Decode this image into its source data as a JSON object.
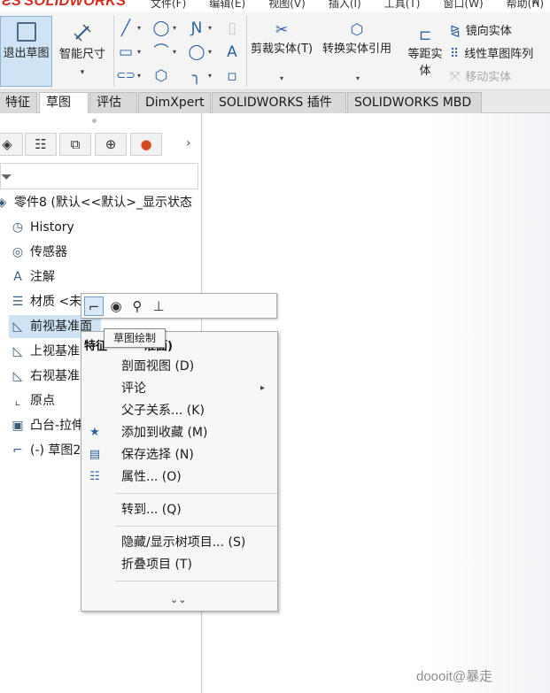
{
  "app": {
    "logo_ds": "ƧS",
    "logo_name": "SOLIDWORKS",
    "menu": [
      "文件(F)",
      "编辑(E)",
      "视图(V)",
      "插入(I)",
      "工具(T)",
      "窗口(W)",
      "帮助(H)"
    ],
    "pin": "⊼"
  },
  "ribbon": {
    "exit_sketch": "退出草图",
    "smart_dim": "智能尺寸",
    "trim": "剪裁实体(T)",
    "convert": "转换实体引用",
    "offset_line1": "等距实",
    "offset_line2": "体",
    "mirror": "镜向实体",
    "linear_pattern": "线性草图阵列",
    "move": "移动实体",
    "sketch_tools": {
      "line": "╱",
      "circle": "◯",
      "spline": "Ɲ",
      "rect": "▭",
      "arc": "⌒",
      "polygon": "◯",
      "slot": "⊂⊃",
      "hexagon": "⬡",
      "fillet": "╮",
      "text": "A",
      "point": "▫",
      "plane3d": "▯"
    }
  },
  "tabs": [
    "特征",
    "草图",
    "评估",
    "DimXpert",
    "SOLIDWORKS 插件",
    "SOLIDWORKS MBD"
  ],
  "tabs_active": 1,
  "panel": {
    "tab_arrow": "›",
    "tree": [
      {
        "icon": "part-icon",
        "glyph": "◈",
        "label": "零件8  (默认<<默认>_显示状态"
      },
      {
        "icon": "history-icon",
        "glyph": "◷",
        "label": "History"
      },
      {
        "icon": "sensor-icon",
        "glyph": "◎",
        "label": "传感器"
      },
      {
        "icon": "annotation-icon",
        "glyph": "A",
        "label": "注解"
      },
      {
        "icon": "material-icon",
        "glyph": "☰",
        "label": "材质 <未"
      },
      {
        "icon": "plane-icon",
        "glyph": "◺",
        "label": "前视基准面"
      },
      {
        "icon": "plane-icon",
        "glyph": "◺",
        "label": "上视基准"
      },
      {
        "icon": "plane-icon",
        "glyph": "◺",
        "label": "右视基准"
      },
      {
        "icon": "origin-icon",
        "glyph": "⌞",
        "label": "原点"
      },
      {
        "icon": "extrude-icon",
        "glyph": "▣",
        "label": "凸台-拉伸"
      },
      {
        "icon": "sketch-icon",
        "glyph": "⌐",
        "label": "(-) 草图2"
      }
    ]
  },
  "tooltip": "草图绘制",
  "context_menu": {
    "title_prefix": "特征",
    "title_suffix": "准面)",
    "items": [
      {
        "label": "剖面视图 (D)",
        "icon": ""
      },
      {
        "label": "评论",
        "icon": "",
        "submenu": "▸"
      },
      {
        "label": "父子关系... (K)",
        "icon": ""
      },
      {
        "label": "添加到收藏 (M)",
        "icon": "★"
      },
      {
        "label": "保存选择 (N)",
        "icon": "▤"
      },
      {
        "label": "属性... (O)",
        "icon": "☷"
      },
      {
        "label": "转到... (Q)",
        "icon": ""
      },
      {
        "label": "隐藏/显示树项目... (S)",
        "icon": ""
      },
      {
        "label": "折叠项目 (T)",
        "icon": ""
      }
    ],
    "expand": "⌄⌄"
  },
  "watermark": "doooit@暴走",
  "colors": {
    "accent": "#2b5f9e",
    "selected": "#cfe3f5",
    "brand": "#d52b1e"
  }
}
